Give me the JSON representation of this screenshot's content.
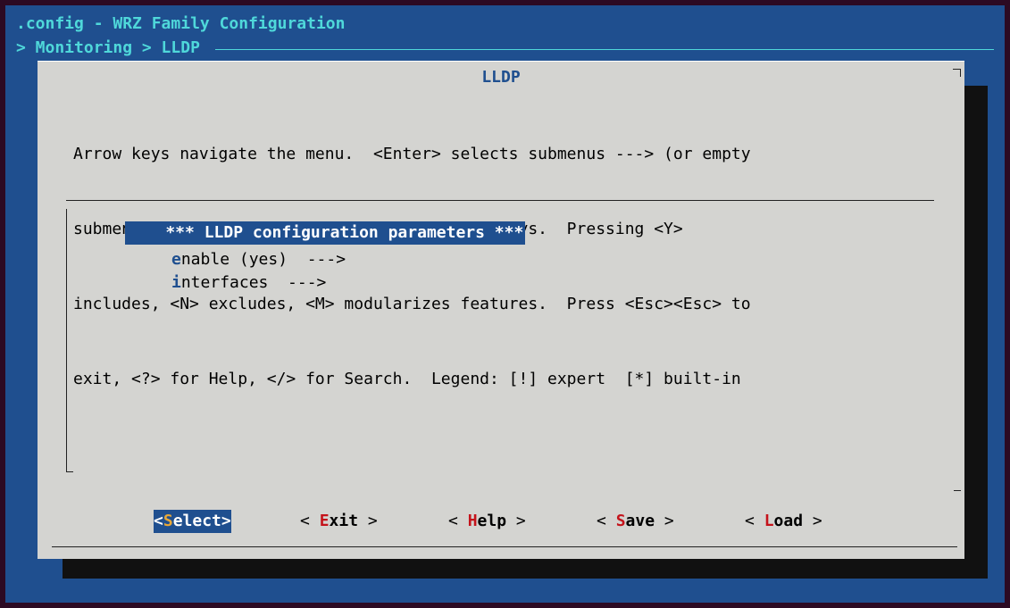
{
  "window": {
    "title": ".config - WRZ Family Configuration",
    "breadcrumb": "> Monitoring > LLDP "
  },
  "dialog": {
    "title": "LLDP",
    "help_lines": [
      "Arrow keys navigate the menu.  <Enter> selects submenus ---> (or empty",
      "submenus ----).  Highlighted letters are hotkeys.  Pressing <Y>",
      "includes, <N> excludes, <M> modularizes features.  Press <Esc><Esc> to",
      "exit, <?> for Help, </> for Search.  Legend: [!] expert  [*] built-in"
    ]
  },
  "menu": {
    "items": [
      {
        "text": "    *** LLDP configuration parameters ***",
        "selected": true
      },
      {
        "hotkey": "e",
        "rest": "nable (yes)  --->"
      },
      {
        "hotkey": "i",
        "rest": "nterfaces  --->"
      }
    ]
  },
  "buttons": [
    {
      "prefix": "<",
      "hotkey": "S",
      "rest": "elect",
      "suffix": ">",
      "selected": true
    },
    {
      "prefix": "< ",
      "hotkey": "E",
      "rest": "xit",
      "suffix": " >"
    },
    {
      "prefix": "< ",
      "hotkey": "H",
      "rest": "elp",
      "suffix": " >"
    },
    {
      "prefix": "< ",
      "hotkey": "S",
      "rest": "ave",
      "suffix": " >"
    },
    {
      "prefix": "< ",
      "hotkey": "L",
      "rest": "oad",
      "suffix": " >"
    }
  ],
  "colors": {
    "terminal_bg": "#1f4f8f",
    "dialog_bg": "#d4d4d1",
    "title_cyan": "#4fd8da",
    "hotkey_blue": "#1f4f8f",
    "button_hotkey_red": "#c4131b",
    "selected_hotkey_yellow": "#e8a838"
  }
}
